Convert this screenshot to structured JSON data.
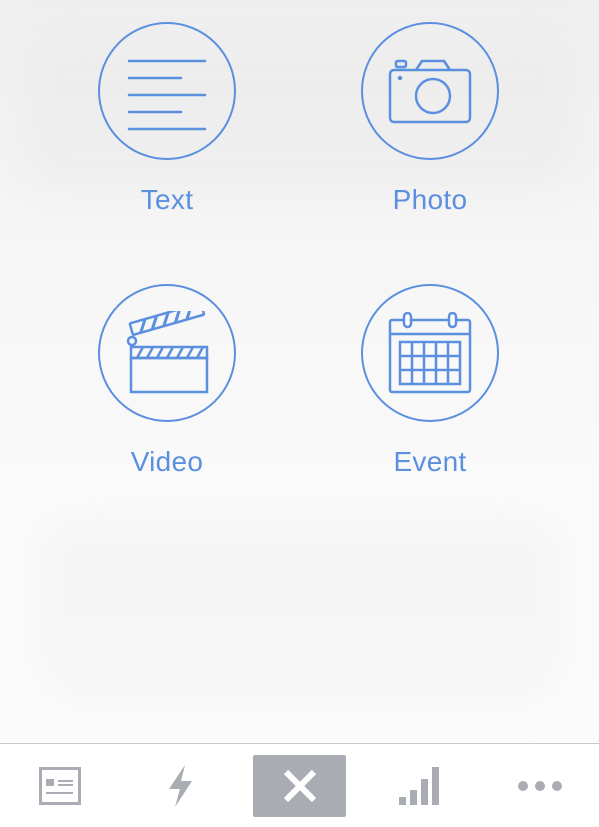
{
  "options": [
    {
      "id": "text",
      "label": "Text",
      "icon": "text-lines-icon"
    },
    {
      "id": "photo",
      "label": "Photo",
      "icon": "camera-icon"
    },
    {
      "id": "video",
      "label": "Video",
      "icon": "clapperboard-icon"
    },
    {
      "id": "event",
      "label": "Event",
      "icon": "calendar-icon"
    }
  ],
  "tabbar": {
    "tabs": [
      {
        "id": "dashboard",
        "icon": "dashboard-card-icon"
      },
      {
        "id": "activity",
        "icon": "lightning-icon"
      },
      {
        "id": "close",
        "icon": "close-x-icon"
      },
      {
        "id": "stats",
        "icon": "signal-bars-icon"
      },
      {
        "id": "more",
        "icon": "more-dots-icon"
      }
    ]
  },
  "colors": {
    "accent": "#5b8fdf",
    "tab_icon": "#a9acb2",
    "close_bg": "#a9acb2",
    "close_fg": "#ffffff"
  }
}
